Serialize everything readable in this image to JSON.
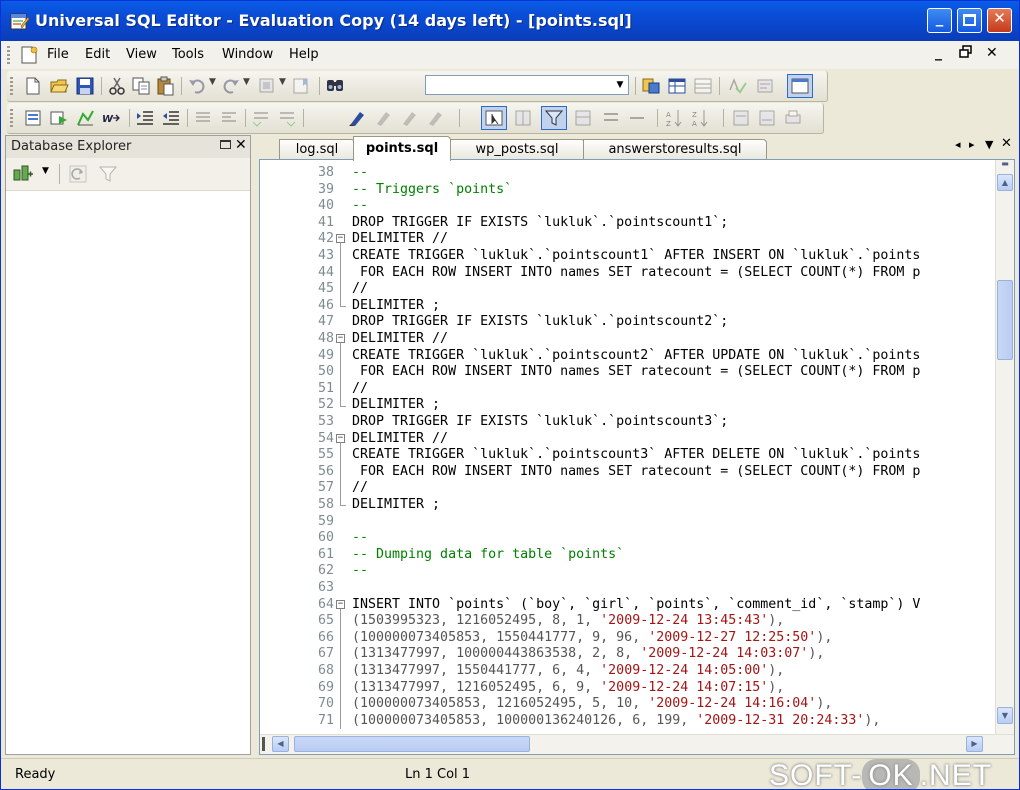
{
  "window": {
    "title": "Universal SQL Editor - Evaluation Copy (14 days left) - [points.sql]",
    "minimize": "_",
    "restore": "❐",
    "close": "✕"
  },
  "menu": [
    "File",
    "Edit",
    "View",
    "Tools",
    "Window",
    "Help"
  ],
  "mdi": {
    "minimize": "_",
    "restore": "🗗",
    "close": "✕"
  },
  "explorer": {
    "title": "Database Explorer"
  },
  "tabs": [
    {
      "label": "log.sql",
      "active": false
    },
    {
      "label": "points.sql",
      "active": true
    },
    {
      "label": "wp_posts.sql",
      "active": false
    },
    {
      "label": "answerstoresults.sql",
      "active": false
    }
  ],
  "colors": {
    "comment": "#008000",
    "string": "#a31515",
    "number": "#555555",
    "linenumber": "#7f8c8c"
  },
  "code_lines": [
    {
      "n": "38",
      "t": "--",
      "c": "com"
    },
    {
      "n": "39",
      "t": "-- Triggers `points`",
      "c": "com"
    },
    {
      "n": "40",
      "t": "--",
      "c": "com"
    },
    {
      "n": "41",
      "t": "DROP TRIGGER IF EXISTS `lukluk`.`pointscount1`;",
      "c": "def"
    },
    {
      "n": "42",
      "t": "DELIMITER //",
      "c": "def",
      "fold": "start"
    },
    {
      "n": "43",
      "t": "CREATE TRIGGER `lukluk`.`pointscount1` AFTER INSERT ON `lukluk`.`points",
      "c": "def"
    },
    {
      "n": "44",
      "t": " FOR EACH ROW INSERT INTO names SET ratecount = (SELECT COUNT(*) FROM p",
      "c": "def"
    },
    {
      "n": "45",
      "t": "//",
      "c": "def"
    },
    {
      "n": "46",
      "t": "DELIMITER ;",
      "c": "def",
      "fold": "end"
    },
    {
      "n": "47",
      "t": "DROP TRIGGER IF EXISTS `lukluk`.`pointscount2`;",
      "c": "def"
    },
    {
      "n": "48",
      "t": "DELIMITER //",
      "c": "def",
      "fold": "start"
    },
    {
      "n": "49",
      "t": "CREATE TRIGGER `lukluk`.`pointscount2` AFTER UPDATE ON `lukluk`.`points",
      "c": "def"
    },
    {
      "n": "50",
      "t": " FOR EACH ROW INSERT INTO names SET ratecount = (SELECT COUNT(*) FROM p",
      "c": "def"
    },
    {
      "n": "51",
      "t": "//",
      "c": "def"
    },
    {
      "n": "52",
      "t": "DELIMITER ;",
      "c": "def",
      "fold": "end"
    },
    {
      "n": "53",
      "t": "DROP TRIGGER IF EXISTS `lukluk`.`pointscount3`;",
      "c": "def"
    },
    {
      "n": "54",
      "t": "DELIMITER //",
      "c": "def",
      "fold": "start"
    },
    {
      "n": "55",
      "t": "CREATE TRIGGER `lukluk`.`pointscount3` AFTER DELETE ON `lukluk`.`points",
      "c": "def"
    },
    {
      "n": "56",
      "t": " FOR EACH ROW INSERT INTO names SET ratecount = (SELECT COUNT(*) FROM p",
      "c": "def"
    },
    {
      "n": "57",
      "t": "//",
      "c": "def"
    },
    {
      "n": "58",
      "t": "DELIMITER ;",
      "c": "def",
      "fold": "end"
    },
    {
      "n": "59",
      "t": "",
      "c": "def"
    },
    {
      "n": "60",
      "t": "--",
      "c": "com"
    },
    {
      "n": "61",
      "t": "-- Dumping data for table `points`",
      "c": "com"
    },
    {
      "n": "62",
      "t": "--",
      "c": "com"
    },
    {
      "n": "63",
      "t": "",
      "c": "def"
    },
    {
      "n": "64",
      "t": "INSERT INTO `points` (`boy`, `girl`, `points`, `comment_id`, `stamp`) V",
      "c": "def",
      "fold": "start"
    },
    {
      "n": "65",
      "p": "(1503995323, 1216052495, 8, 1, ",
      "s": "'2009-12-24 13:45:43'",
      "e": "),"
    },
    {
      "n": "66",
      "p": "(100000073405853, 1550441777, 9, 96, ",
      "s": "'2009-12-27 12:25:50'",
      "e": "),"
    },
    {
      "n": "67",
      "p": "(1313477997, 100000443863538, 2, 8, ",
      "s": "'2009-12-24 14:03:07'",
      "e": "),"
    },
    {
      "n": "68",
      "p": "(1313477997, 1550441777, 6, 4, ",
      "s": "'2009-12-24 14:05:00'",
      "e": "),"
    },
    {
      "n": "69",
      "p": "(1313477997, 1216052495, 6, 9, ",
      "s": "'2009-12-24 14:07:15'",
      "e": "),"
    },
    {
      "n": "70",
      "p": "(100000073405853, 1216052495, 5, 10, ",
      "s": "'2009-12-24 14:16:04'",
      "e": "),"
    },
    {
      "n": "71",
      "p": "(100000073405853, 100000136240126, 6, 199, ",
      "s": "'2009-12-31 20:24:33'",
      "e": "),"
    }
  ],
  "status": {
    "ready": "Ready",
    "position": "Ln 1 Col 1"
  },
  "watermark": {
    "left": "SOFT-",
    "ok": "OK",
    ".net": ".NET"
  }
}
